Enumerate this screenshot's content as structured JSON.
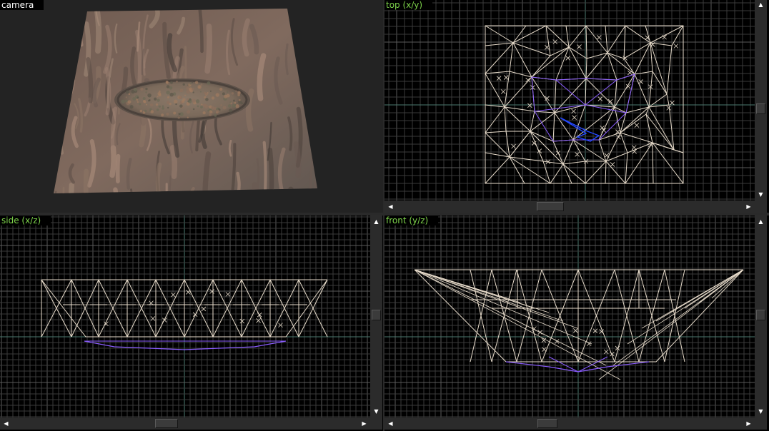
{
  "viewports": {
    "camera": {
      "label": "camera"
    },
    "top": {
      "label": "top (x/y)"
    },
    "side": {
      "label": "side (x/z)"
    },
    "front": {
      "label": "front (y/z)"
    }
  },
  "colors": {
    "camera_label": "#ffffff",
    "ortho_label": "#7dd34a",
    "wire": "#e8dccb",
    "selected_wire": "#8a5cff",
    "grid_minor": "#3a3a3a",
    "grid_major": "#5a5a5a",
    "axis": "#4c7a70"
  },
  "icons": {
    "scroll_up": "▲",
    "scroll_down": "▼",
    "scroll_left": "◀",
    "scroll_right": "▶"
  }
}
